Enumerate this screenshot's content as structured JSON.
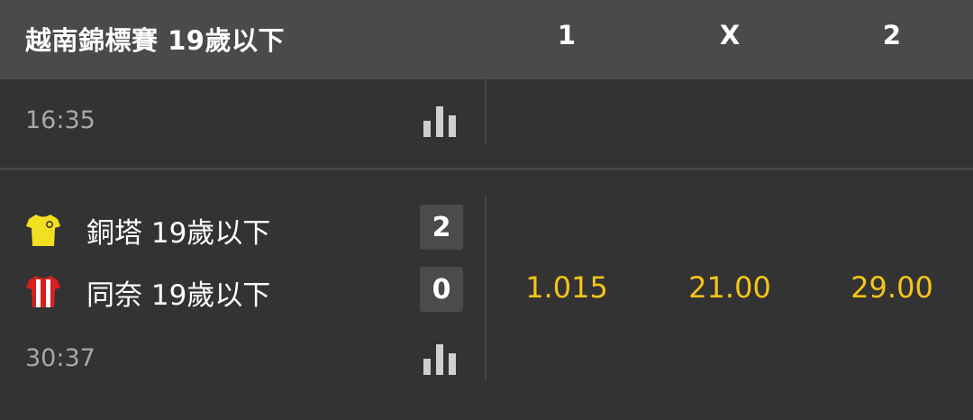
{
  "header": {
    "league": "越南錦標賽 19歲以下",
    "col_1": "1",
    "col_x": "X",
    "col_2": "2"
  },
  "events": [
    {
      "time": "16:35",
      "stats_icon": "stats-bars-icon"
    },
    {
      "time": "30:37",
      "stats_icon": "stats-bars-icon",
      "home": {
        "name": "銅塔 19歲以下",
        "score": "2",
        "kit_color": "#f2e020"
      },
      "away": {
        "name": "同奈 19歲以下",
        "score": "0",
        "kit_color": "#d62020"
      },
      "odds": {
        "home": "1.015",
        "draw": "21.00",
        "away": "29.00"
      }
    }
  ],
  "colors": {
    "header_bg": "#4a4a4a",
    "row_bg": "#333333",
    "odds": "#f5c518",
    "muted_text": "#a8a8a8"
  }
}
